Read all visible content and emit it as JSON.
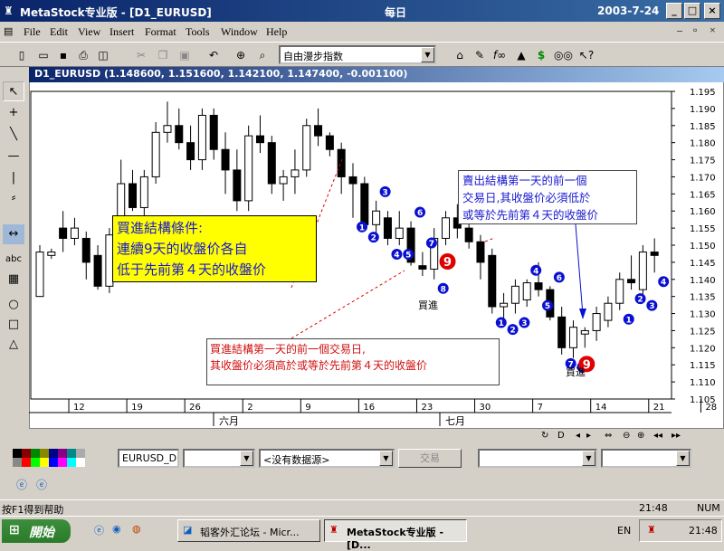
{
  "window": {
    "app_title": "MetaStock专业版 - [D1_EURUSD]",
    "center_title": "每日",
    "date": "2003-7-24"
  },
  "menu": [
    "File",
    "Edit",
    "View",
    "Insert",
    "Format",
    "Tools",
    "Window",
    "Help"
  ],
  "toolbar": {
    "indicator_combo": "自由漫步指数"
  },
  "chart": {
    "title": "D1_EURUSD (1.148600, 1.151600, 1.142100, 1.147400, -0.001100)",
    "yticks": [
      "1.195",
      "1.190",
      "1.185",
      "1.180",
      "1.175",
      "1.170",
      "1.165",
      "1.160",
      "1.155",
      "1.150",
      "1.145",
      "1.140",
      "1.135",
      "1.130",
      "1.125",
      "1.120",
      "1.115",
      "1.110",
      "1.105"
    ],
    "xticks": [
      "12",
      "19",
      "26",
      "2",
      "9",
      "16",
      "23",
      "30",
      "7",
      "14",
      "21",
      "28"
    ],
    "months": [
      "六月",
      "七月"
    ],
    "annotation_buy_conditions": [
      "買進結構條件:",
      "連續9天的收盤价各自",
      "低于先前第４天的收盤价"
    ],
    "annotation_sell": [
      "賣出結構第一天的前一個",
      "交易日,其收盤价必須低於",
      "或等於先前第４天的收盤价"
    ],
    "annotation_buy_prev": [
      "買進結構第一天的前一個交易日,",
      "其收盤价必須高於或等於先前第４天的收盤价"
    ],
    "buy_label": "買進"
  },
  "chart_data": {
    "type": "candlestick",
    "ylim": [
      1.105,
      1.195
    ],
    "x_tick_labels": [
      "12",
      "19",
      "26",
      "2",
      "9",
      "16",
      "23",
      "30",
      "7",
      "14",
      "21",
      "28"
    ],
    "month_labels": [
      "六月",
      "七月"
    ],
    "candles": [
      {
        "o": 1.135,
        "h": 1.15,
        "l": 1.135,
        "c": 1.148
      },
      {
        "o": 1.147,
        "h": 1.149,
        "l": 1.146,
        "c": 1.148
      },
      {
        "o": 1.155,
        "h": 1.16,
        "l": 1.148,
        "c": 1.152
      },
      {
        "o": 1.152,
        "h": 1.158,
        "l": 1.15,
        "c": 1.155
      },
      {
        "o": 1.152,
        "h": 1.154,
        "l": 1.14,
        "c": 1.145
      },
      {
        "o": 1.147,
        "h": 1.15,
        "l": 1.137,
        "c": 1.138
      },
      {
        "o": 1.138,
        "h": 1.155,
        "l": 1.136,
        "c": 1.153
      },
      {
        "o": 1.153,
        "h": 1.175,
        "l": 1.15,
        "c": 1.168
      },
      {
        "o": 1.168,
        "h": 1.172,
        "l": 1.16,
        "c": 1.161
      },
      {
        "o": 1.161,
        "h": 1.172,
        "l": 1.158,
        "c": 1.17
      },
      {
        "o": 1.17,
        "h": 1.186,
        "l": 1.168,
        "c": 1.183
      },
      {
        "o": 1.183,
        "h": 1.192,
        "l": 1.18,
        "c": 1.185
      },
      {
        "o": 1.185,
        "h": 1.19,
        "l": 1.178,
        "c": 1.18
      },
      {
        "o": 1.18,
        "h": 1.185,
        "l": 1.172,
        "c": 1.175
      },
      {
        "o": 1.175,
        "h": 1.19,
        "l": 1.172,
        "c": 1.188
      },
      {
        "o": 1.188,
        "h": 1.19,
        "l": 1.175,
        "c": 1.178
      },
      {
        "o": 1.178,
        "h": 1.183,
        "l": 1.165,
        "c": 1.172
      },
      {
        "o": 1.172,
        "h": 1.178,
        "l": 1.16,
        "c": 1.163
      },
      {
        "o": 1.163,
        "h": 1.185,
        "l": 1.16,
        "c": 1.182
      },
      {
        "o": 1.182,
        "h": 1.188,
        "l": 1.177,
        "c": 1.18
      },
      {
        "o": 1.18,
        "h": 1.182,
        "l": 1.165,
        "c": 1.168
      },
      {
        "o": 1.168,
        "h": 1.172,
        "l": 1.163,
        "c": 1.17
      },
      {
        "o": 1.17,
        "h": 1.178,
        "l": 1.165,
        "c": 1.172
      },
      {
        "o": 1.172,
        "h": 1.187,
        "l": 1.17,
        "c": 1.185
      },
      {
        "o": 1.185,
        "h": 1.19,
        "l": 1.179,
        "c": 1.182
      },
      {
        "o": 1.182,
        "h": 1.183,
        "l": 1.176,
        "c": 1.178
      },
      {
        "o": 1.178,
        "h": 1.18,
        "l": 1.165,
        "c": 1.17
      },
      {
        "o": 1.17,
        "h": 1.174,
        "l": 1.158,
        "c": 1.168
      },
      {
        "o": 1.168,
        "h": 1.17,
        "l": 1.155,
        "c": 1.156
      },
      {
        "o": 1.156,
        "h": 1.163,
        "l": 1.152,
        "c": 1.16
      },
      {
        "o": 1.158,
        "h": 1.16,
        "l": 1.15,
        "c": 1.152
      },
      {
        "o": 1.152,
        "h": 1.16,
        "l": 1.15,
        "c": 1.155
      },
      {
        "o": 1.155,
        "h": 1.157,
        "l": 1.144,
        "c": 1.145
      },
      {
        "o": 1.144,
        "h": 1.148,
        "l": 1.141,
        "c": 1.143
      },
      {
        "o": 1.143,
        "h": 1.155,
        "l": 1.14,
        "c": 1.152
      },
      {
        "o": 1.152,
        "h": 1.16,
        "l": 1.15,
        "c": 1.158
      },
      {
        "o": 1.158,
        "h": 1.162,
        "l": 1.152,
        "c": 1.155
      },
      {
        "o": 1.155,
        "h": 1.158,
        "l": 1.149,
        "c": 1.151
      },
      {
        "o": 1.151,
        "h": 1.153,
        "l": 1.14,
        "c": 1.145
      },
      {
        "o": 1.147,
        "h": 1.149,
        "l": 1.13,
        "c": 1.132
      },
      {
        "o": 1.132,
        "h": 1.136,
        "l": 1.128,
        "c": 1.133
      },
      {
        "o": 1.133,
        "h": 1.14,
        "l": 1.13,
        "c": 1.138
      },
      {
        "o": 1.134,
        "h": 1.14,
        "l": 1.132,
        "c": 1.139
      },
      {
        "o": 1.139,
        "h": 1.145,
        "l": 1.135,
        "c": 1.137
      },
      {
        "o": 1.137,
        "h": 1.138,
        "l": 1.128,
        "c": 1.129
      },
      {
        "o": 1.129,
        "h": 1.132,
        "l": 1.118,
        "c": 1.12
      },
      {
        "o": 1.12,
        "h": 1.128,
        "l": 1.117,
        "c": 1.126
      },
      {
        "o": 1.124,
        "h": 1.126,
        "l": 1.12,
        "c": 1.125
      },
      {
        "o": 1.125,
        "h": 1.132,
        "l": 1.122,
        "c": 1.13
      },
      {
        "o": 1.128,
        "h": 1.135,
        "l": 1.126,
        "c": 1.133
      },
      {
        "o": 1.133,
        "h": 1.142,
        "l": 1.131,
        "c": 1.14
      },
      {
        "o": 1.14,
        "h": 1.147,
        "l": 1.137,
        "c": 1.139
      },
      {
        "o": 1.137,
        "h": 1.15,
        "l": 1.135,
        "c": 1.148
      },
      {
        "o": 1.148,
        "h": 1.152,
        "l": 1.142,
        "c": 1.147
      }
    ]
  },
  "bottombar": {
    "symbol_field": "EURUSD_D",
    "datasource": "<没有数据源>",
    "trade_button": "交易"
  },
  "status": {
    "help": "按F1得到帮助",
    "time": "21:48",
    "num": "NUM"
  },
  "taskbar": {
    "start": "開始",
    "task1": "韬客外汇论坛 - Micr...",
    "task2": "MetaStock专业版 - [D...",
    "lang": "EN",
    "clock": "21:48"
  }
}
